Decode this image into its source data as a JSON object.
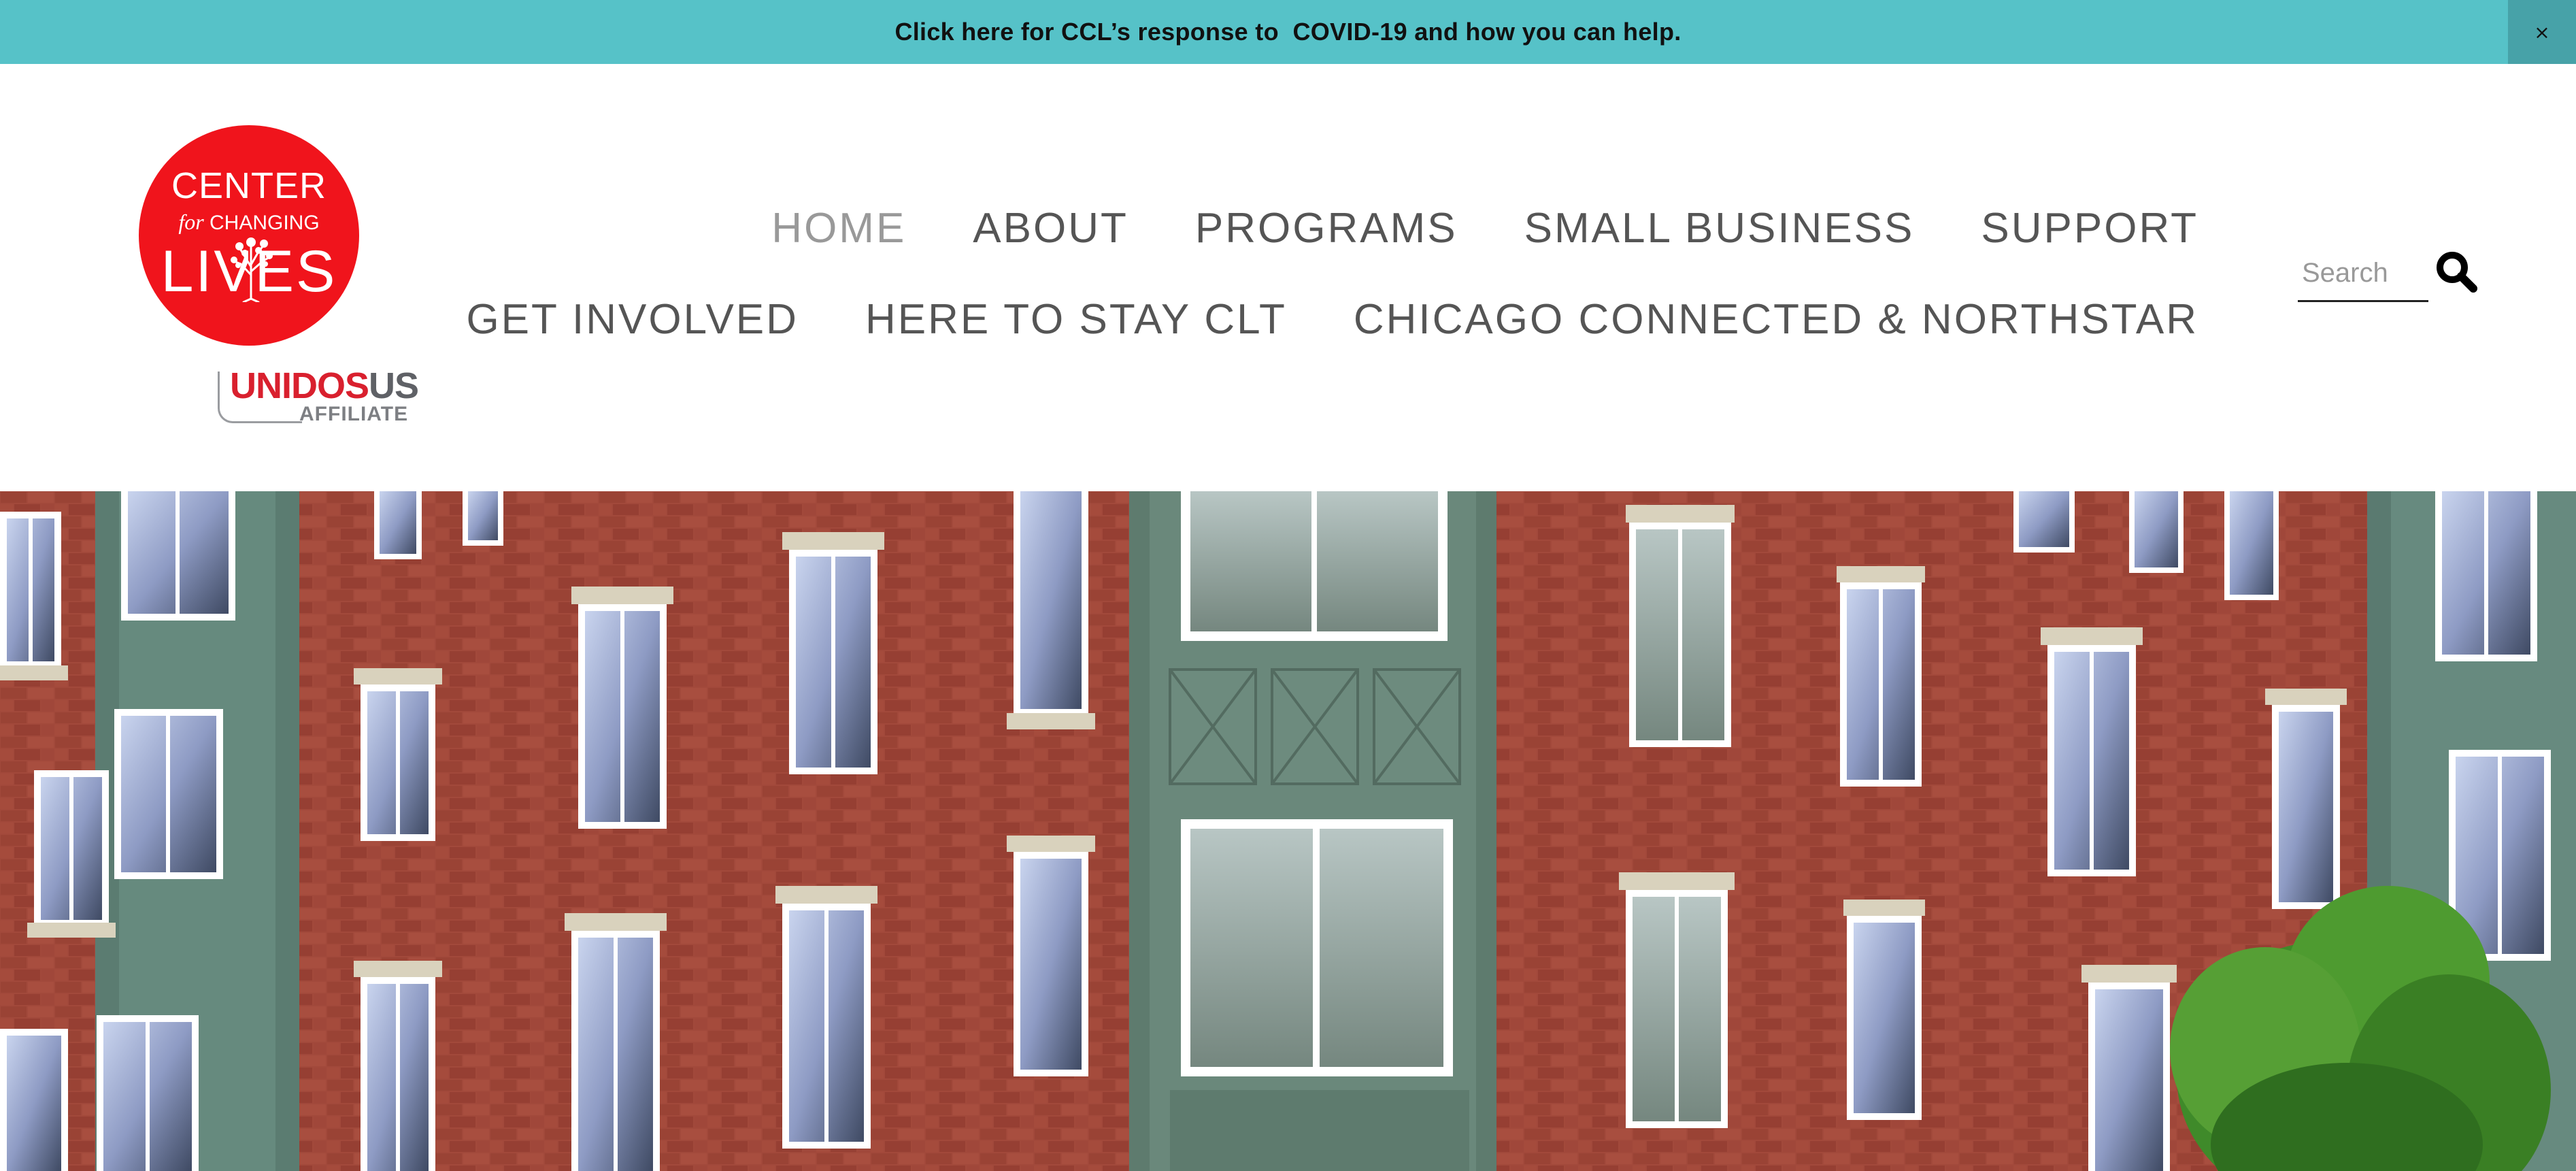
{
  "announcement": {
    "text": "Click here for CCL’s response to  COVID-19 and how you can help.",
    "close_label": "×"
  },
  "logo": {
    "line1": "CENTER",
    "line2_for": "for",
    "line2_rest": " CHANGING",
    "line3": "LIVES",
    "brand_color": "#f0141c"
  },
  "affiliate": {
    "part1": "UNID",
    "part2": "OS",
    "part3": "US",
    "sub": "AFFILIATE"
  },
  "nav": {
    "row1": [
      "HOME",
      "ABOUT",
      "PROGRAMS",
      "SMALL BUSINESS",
      "SUPPORT"
    ],
    "row2": [
      "GET INVOLVED",
      "HERE TO STAY CLT",
      "CHICAGO CONNECTED & NORTHSTAR"
    ],
    "active": "HOME"
  },
  "search": {
    "placeholder": "Search",
    "icon": "search-icon"
  },
  "hero": {
    "subject": "brick apartment building"
  },
  "colors": {
    "announce_bg": "#56c2c8",
    "announce_close_bg": "#47a2a8",
    "nav_text": "#555555",
    "nav_active": "#999999"
  }
}
